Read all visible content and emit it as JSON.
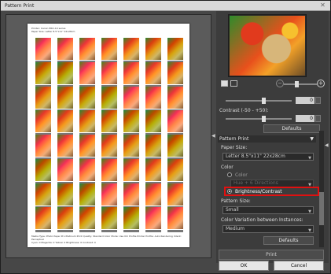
{
  "window": {
    "title": "Pattern Print",
    "close_label": "✕"
  },
  "preview": {
    "header_text": "Printer: Canon PRO-10 series\nPaper Size: Letter 8.5\"x11\" 22x28cm",
    "footer_text": "Media Type: Photo Paper Pro Platinum   Print Quality: Standard   Color Mode: Use ICC Profile   Printer Profile: Auto   Rendering Intent: Perceptual\nCyan: 0  Magenta: 0  Yellow: 0  Brightness: 0  Contrast: 0",
    "rows": 8,
    "cols": 7
  },
  "panel": {
    "contrast_label": "Contrast (-50 - +50):",
    "brightness_value": "0",
    "contrast_value": "0",
    "defaults_label_top": "Defaults",
    "section_title": "Pattern Print",
    "paper_size_label": "Paper Size:",
    "paper_size_value": "Letter 8.5\"x11\" 22x28cm",
    "color_label": "Color",
    "color_option_label": "Color",
    "color_combo_value": "Hue + 6 Directions",
    "brightness_contrast_label": "Brightness/Contrast",
    "pattern_size_label": "Pattern Size:",
    "pattern_size_value": "Small",
    "variation_label": "Color Variation between Instances:",
    "variation_value": "Medium",
    "defaults_label_bottom": "Defaults",
    "print_label": "Print"
  },
  "buttons": {
    "ok": "OK",
    "cancel": "Cancel"
  },
  "colors": {
    "highlight": "#e01010",
    "panel_bg": "#3c3c3c",
    "window_bg": "#474747"
  }
}
